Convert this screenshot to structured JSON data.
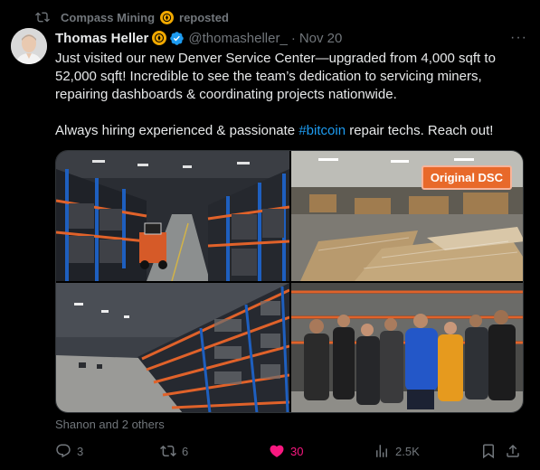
{
  "repost": {
    "account": "Compass Mining",
    "label": "reposted"
  },
  "author": {
    "name": "Thomas Heller",
    "handle": "@thomasheller_",
    "separator": "·",
    "date": "Nov 20"
  },
  "text": {
    "line1": "Just visited our new Denver Service Center—upgraded from 4,000 sqft to 52,000 sqft! Incredible to see the team’s dedication to servicing miners, repairing dashboards & coordinating projects nationwide.",
    "line2_before": "Always hiring experienced & passionate ",
    "hashtag": "#bitcoin",
    "line2_after": " repair techs. Reach out!"
  },
  "media": {
    "overlay_label": "Original DSC"
  },
  "likers": "Shanon and 2 others",
  "actions": {
    "replies": "3",
    "reposts": "6",
    "likes": "30",
    "views": "2.5K"
  },
  "colors": {
    "accent": "#1d9bf0",
    "like": "#f91880",
    "muted": "#71767b",
    "badge": "#f2a900"
  },
  "icons": [
    "repost-icon",
    "compass-badge-icon",
    "verified-icon",
    "more-icon",
    "reply-icon",
    "like-icon",
    "views-icon",
    "bookmark-icon",
    "share-icon"
  ]
}
